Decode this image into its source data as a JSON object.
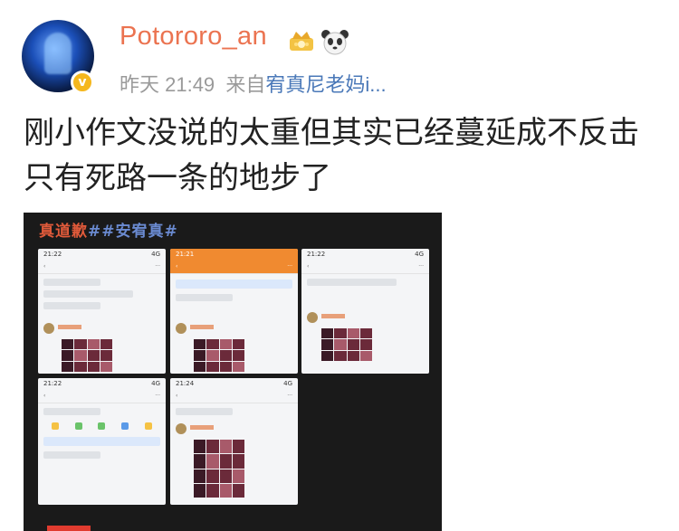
{
  "post": {
    "username": "Potororo_an",
    "time": "昨天 21:49",
    "source_prefix": "来自",
    "source": "宥真尼老妈i...",
    "text_line1": "刚小作文没说的太重但其实已经蔓延成不反击",
    "text_line2": "只有死路一条的地步了"
  },
  "image": {
    "tag": "真道歉",
    "hashtag": "##安宥真#"
  },
  "screenshots": [
    {
      "time": "21:22",
      "signal": "4G"
    },
    {
      "time": "21:21",
      "signal": ""
    },
    {
      "time": "21:22",
      "signal": "4G"
    },
    {
      "time": "21:22",
      "signal": "4G"
    },
    {
      "time": "21:24",
      "signal": "4G"
    }
  ],
  "icons": {
    "verified": "verified-badge-icon",
    "crown": "crown-badge-icon",
    "panda": "panda-icon"
  },
  "colors": {
    "username": "#eb7350",
    "source_link": "#4a78b8",
    "meta": "#9a9a9a",
    "verified": "#f5b71d"
  }
}
